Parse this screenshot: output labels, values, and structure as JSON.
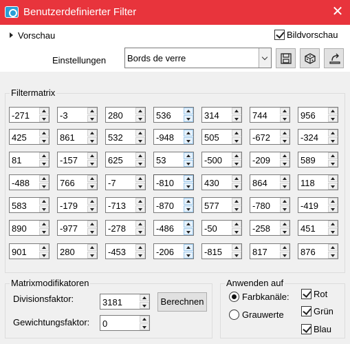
{
  "window": {
    "title": "Benutzerdefinierter Filter",
    "close_glyph": "✕"
  },
  "top": {
    "vorschau_label": "Vorschau",
    "bildvorschau_label": "Bildvorschau",
    "bildvorschau_checked": true,
    "einstellungen_label": "Einstellungen",
    "preset_value": "Bords de verre",
    "buttons": [
      "save-icon",
      "dice-icon",
      "restore-icon"
    ]
  },
  "matrix": {
    "label": "Filtermatrix",
    "rows": [
      [
        "-271",
        "-3",
        "280",
        "536",
        "314",
        "744",
        "956"
      ],
      [
        "425",
        "861",
        "532",
        "-948",
        "505",
        "-672",
        "-324"
      ],
      [
        "81",
        "-157",
        "625",
        "53",
        "-500",
        "-209",
        "589"
      ],
      [
        "-488",
        "766",
        "-7",
        "-810",
        "430",
        "864",
        "118"
      ],
      [
        "583",
        "-179",
        "-713",
        "-870",
        "577",
        "-780",
        "-419"
      ],
      [
        "890",
        "-977",
        "-278",
        "-486",
        "-50",
        "-258",
        "451"
      ],
      [
        "901",
        "280",
        "-453",
        "-206",
        "-815",
        "817",
        "876"
      ]
    ]
  },
  "modifiers": {
    "label": "Matrixmodifikatoren",
    "divisor_label": "Divisionsfaktor:",
    "divisor_value": "3181",
    "bias_label": "Gewichtungsfaktor:",
    "bias_value": "0",
    "calc_label": "Berechnen"
  },
  "apply": {
    "label": "Anwenden auf",
    "radio_channels": "Farbkanäle:",
    "radio_gray": "Grauwerte",
    "red": "Rot",
    "green": "Grün",
    "blue": "Blau"
  }
}
